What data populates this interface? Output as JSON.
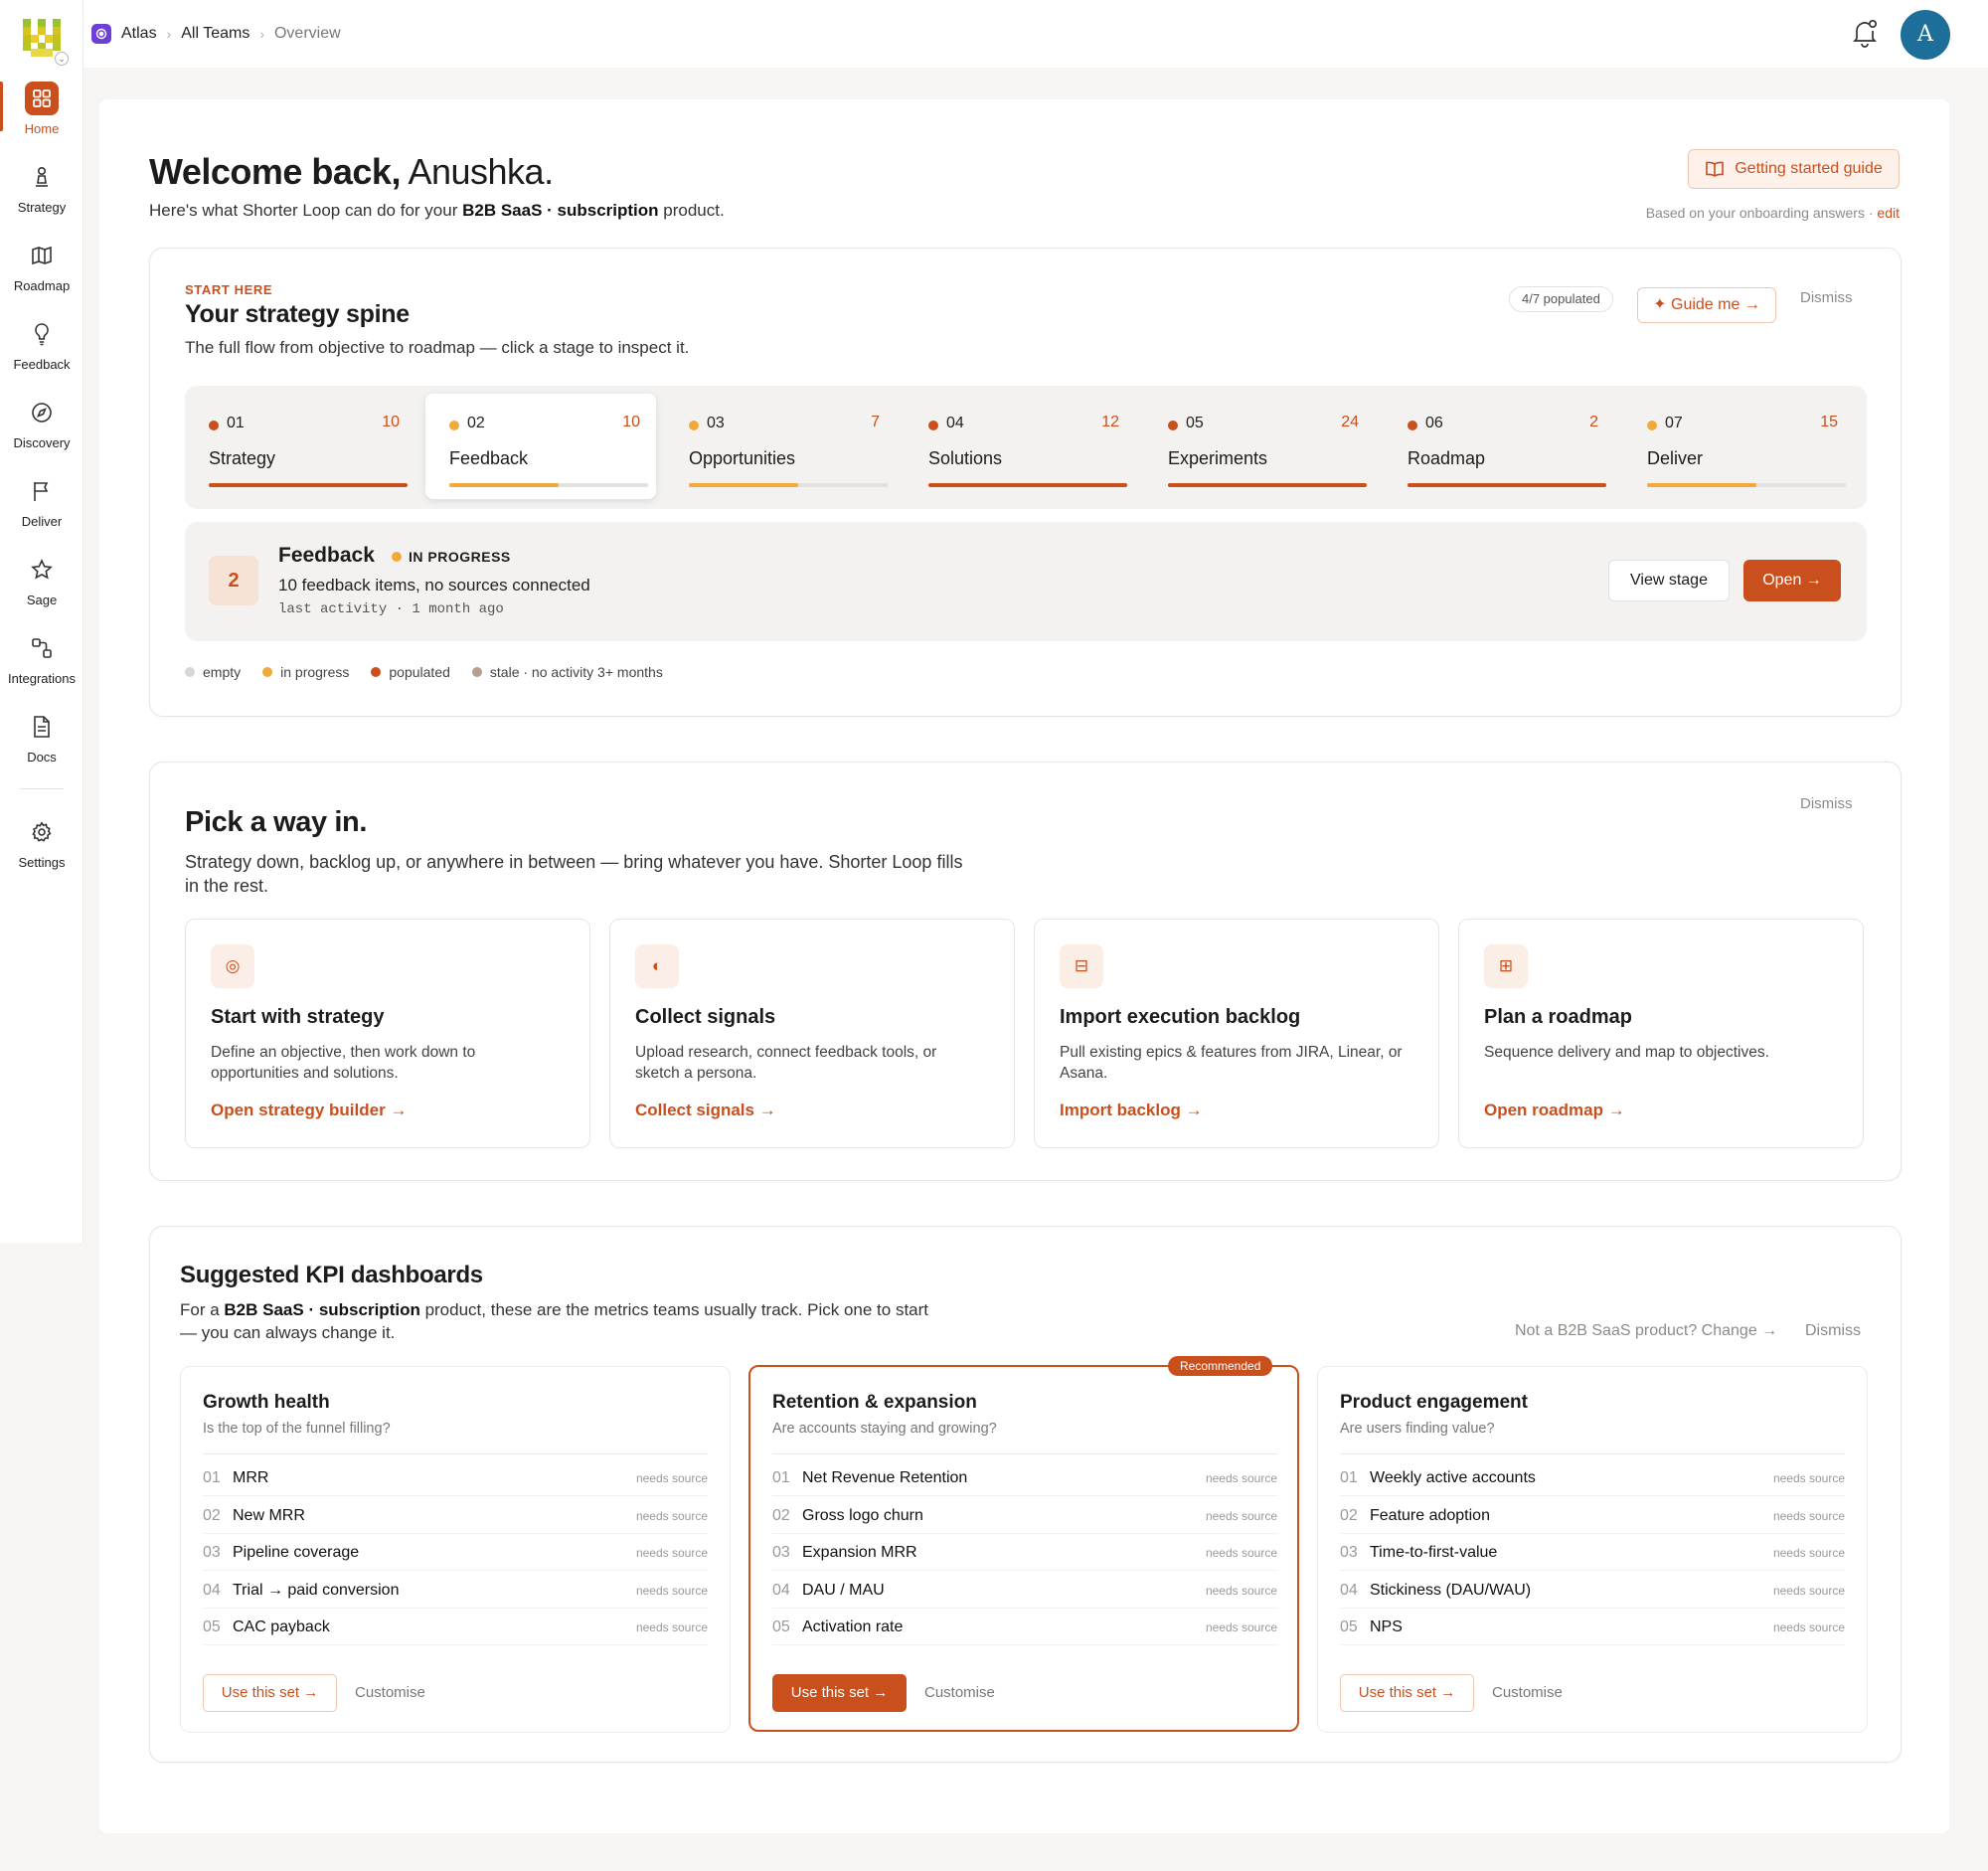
{
  "sidebar": {
    "items": [
      {
        "label": "Home",
        "icon": "home-grid-icon"
      },
      {
        "label": "Strategy",
        "icon": "chess-pawn-icon"
      },
      {
        "label": "Roadmap",
        "icon": "map-icon"
      },
      {
        "label": "Feedback",
        "icon": "lightbulb-icon"
      },
      {
        "label": "Discovery",
        "icon": "compass-icon"
      },
      {
        "label": "Deliver",
        "icon": "flag-icon"
      },
      {
        "label": "Sage",
        "icon": "star-icon"
      },
      {
        "label": "Integrations",
        "icon": "integrations-icon"
      },
      {
        "label": "Docs",
        "icon": "document-icon"
      },
      {
        "label": "Settings",
        "icon": "gear-icon"
      }
    ]
  },
  "breadcrumb": {
    "workspace": "Atlas",
    "team": "All Teams",
    "current": "Overview",
    "separator": "›"
  },
  "avatar": {
    "initial": "A"
  },
  "welcome": {
    "greeting": "Welcome back,",
    "name": " Anushka.",
    "sub_prefix": "Here's what Shorter Loop can do for your ",
    "sub_bold": "B2B SaaS · subscription",
    "sub_suffix": " product.",
    "guide_label": "Getting started guide",
    "based_on": "Based on your onboarding answers · ",
    "edit_label": "edit"
  },
  "spine": {
    "eyebrow": "START HERE",
    "title": "Your strategy spine",
    "subtitle": "The full flow from objective to roadmap — click a stage to inspect it.",
    "populated": "4/7 populated",
    "guide_me": "✦ Guide me →",
    "dismiss": "Dismiss",
    "stages": [
      {
        "num": "01",
        "name": "Strategy",
        "count": "10",
        "status": "populated",
        "progress": 1.0
      },
      {
        "num": "02",
        "name": "Feedback",
        "count": "10",
        "status": "in-progress",
        "progress": 0.55
      },
      {
        "num": "03",
        "name": "Opportunities",
        "count": "7",
        "status": "in-progress",
        "progress": 0.55
      },
      {
        "num": "04",
        "name": "Solutions",
        "count": "12",
        "status": "populated",
        "progress": 1.0
      },
      {
        "num": "05",
        "name": "Experiments",
        "count": "24",
        "status": "populated",
        "progress": 1.0
      },
      {
        "num": "06",
        "name": "Roadmap",
        "count": "2",
        "status": "populated",
        "progress": 1.0
      },
      {
        "num": "07",
        "name": "Deliver",
        "count": "15",
        "status": "in-progress",
        "progress": 0.55
      }
    ],
    "detail": {
      "num": "2",
      "title": "Feedback",
      "status": "IN PROGRESS",
      "description": "10 feedback items, no sources connected",
      "activity": "last activity · 1 month ago",
      "view_label": "View stage",
      "open_label": "Open →"
    },
    "legend": [
      {
        "label": "empty",
        "color": "#d9d7d3"
      },
      {
        "label": "in progress",
        "color": "#f2a93b"
      },
      {
        "label": "populated",
        "color": "#c94f1d"
      },
      {
        "label": "stale · no activity 3+ months",
        "color": "#b49e8f"
      }
    ]
  },
  "pick": {
    "title": "Pick a way in.",
    "subtitle": "Strategy down, backlog up, or anywhere in between — bring whatever you have. Shorter Loop fills in the rest.",
    "dismiss": "Dismiss",
    "ways": [
      {
        "icon": "target-icon",
        "glyph": "◎",
        "title": "Start with strategy",
        "desc": "Define an objective, then work down to opportunities and solutions.",
        "link": "Open strategy builder →"
      },
      {
        "icon": "half-circle-icon",
        "glyph": "◐",
        "title": "Collect signals",
        "desc": "Upload research, connect feedback tools, or sketch a persona.",
        "link": "Collect signals →"
      },
      {
        "icon": "backlog-icon",
        "glyph": "⊟",
        "title": "Import execution backlog",
        "desc": "Pull existing epics & features from JIRA, Linear, or Asana.",
        "link": "Import backlog →"
      },
      {
        "icon": "roadmap-grid-icon",
        "glyph": "⊞",
        "title": "Plan a roadmap",
        "desc": "Sequence delivery and map to objectives.",
        "link": "Open roadmap →"
      }
    ]
  },
  "kpi": {
    "title": "Suggested KPI dashboards",
    "sub_prefix": "For a ",
    "sub_bold": "B2B SaaS · subscription",
    "sub_suffix": " product, these are the metrics teams usually track. Pick one to start — you can always change it.",
    "change": "Not a B2B SaaS product? Change →",
    "dismiss": "Dismiss",
    "use_label": "Use this set →",
    "customise_label": "Customise",
    "recommended_label": "Recommended",
    "sets": [
      {
        "title": "Growth health",
        "subtitle": "Is the top of the funnel filling?",
        "recommended": false,
        "metrics": [
          {
            "n": "01",
            "name": "MRR",
            "status": "needs source"
          },
          {
            "n": "02",
            "name": "New MRR",
            "status": "needs source"
          },
          {
            "n": "03",
            "name": "Pipeline coverage",
            "status": "needs source"
          },
          {
            "n": "04",
            "name": "Trial → paid conversion",
            "status": "needs source"
          },
          {
            "n": "05",
            "name": "CAC payback",
            "status": "needs source"
          }
        ]
      },
      {
        "title": "Retention & expansion",
        "subtitle": "Are accounts staying and growing?",
        "recommended": true,
        "metrics": [
          {
            "n": "01",
            "name": "Net Revenue Retention",
            "status": "needs source"
          },
          {
            "n": "02",
            "name": "Gross logo churn",
            "status": "needs source"
          },
          {
            "n": "03",
            "name": "Expansion MRR",
            "status": "needs source"
          },
          {
            "n": "04",
            "name": "DAU / MAU",
            "status": "needs source"
          },
          {
            "n": "05",
            "name": "Activation rate",
            "status": "needs source"
          }
        ]
      },
      {
        "title": "Product engagement",
        "subtitle": "Are users finding value?",
        "recommended": false,
        "metrics": [
          {
            "n": "01",
            "name": "Weekly active accounts",
            "status": "needs source"
          },
          {
            "n": "02",
            "name": "Feature adoption",
            "status": "needs source"
          },
          {
            "n": "03",
            "name": "Time-to-first-value",
            "status": "needs source"
          },
          {
            "n": "04",
            "name": "Stickiness (DAU/WAU)",
            "status": "needs source"
          },
          {
            "n": "05",
            "name": "NPS",
            "status": "needs source"
          }
        ]
      }
    ]
  },
  "colors": {
    "accent": "#c94f1d",
    "in_progress": "#f2a93b",
    "track": "#e3e1dd"
  }
}
